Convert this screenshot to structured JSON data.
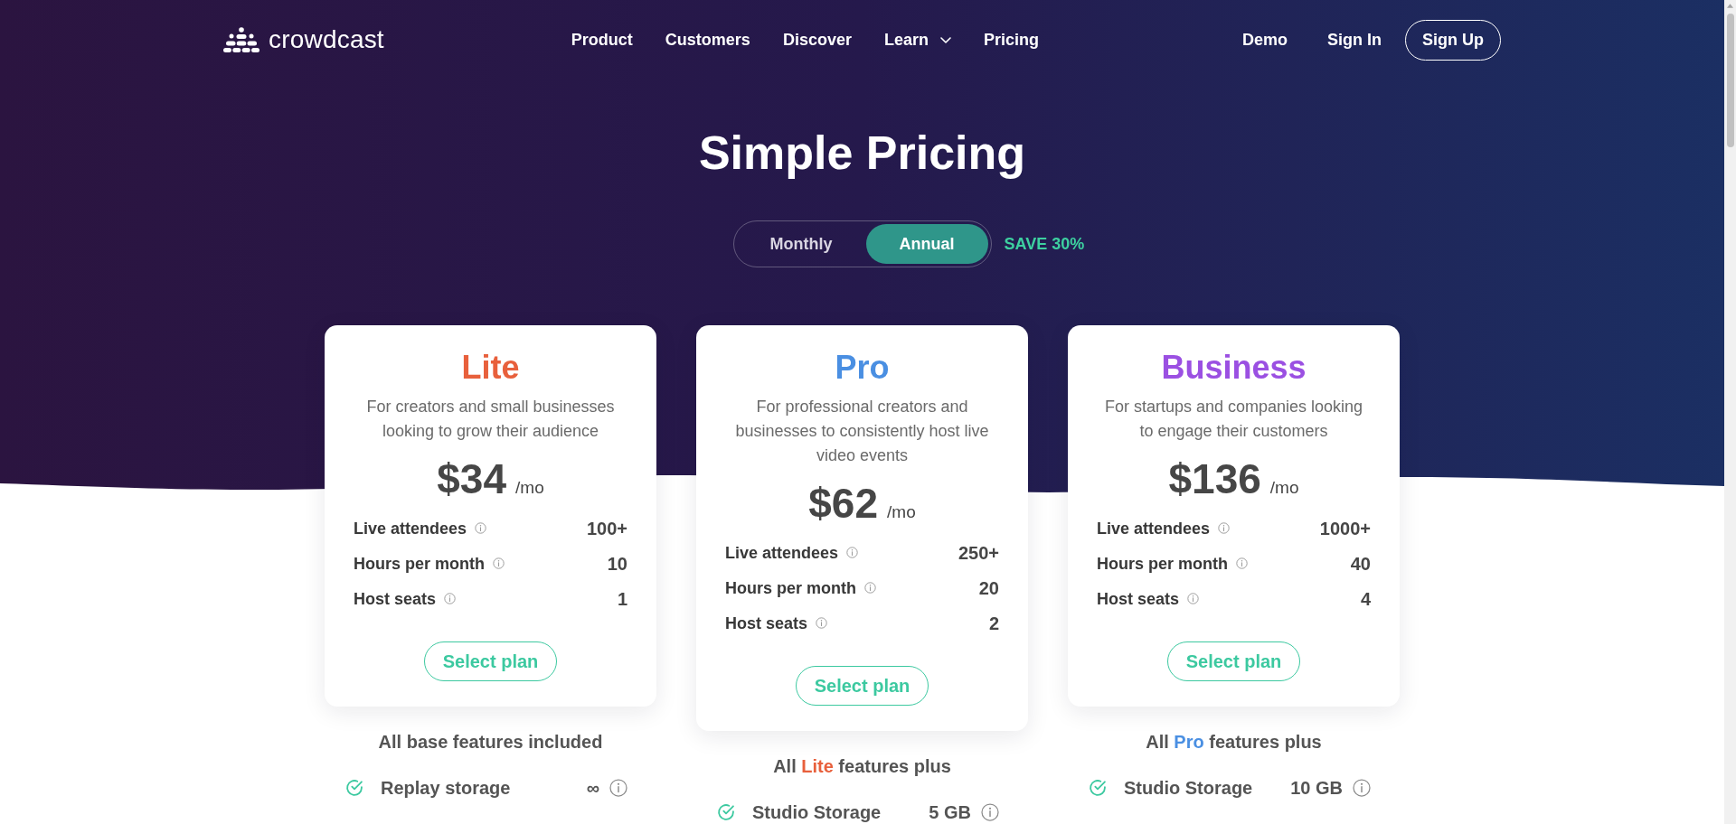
{
  "header": {
    "logo": "crowdcast",
    "nav": [
      {
        "label": "Product",
        "dropdown": false
      },
      {
        "label": "Customers",
        "dropdown": false
      },
      {
        "label": "Discover",
        "dropdown": false
      },
      {
        "label": "Learn",
        "dropdown": true
      },
      {
        "label": "Pricing",
        "dropdown": false
      }
    ],
    "actions": [
      {
        "label": "Demo",
        "kind": "link"
      },
      {
        "label": "Sign In",
        "kind": "link"
      },
      {
        "label": "Sign Up",
        "kind": "button"
      }
    ]
  },
  "hero": {
    "title": "Simple Pricing",
    "billing_toggle": {
      "options": [
        {
          "label": "Monthly",
          "selected": false
        },
        {
          "label": "Annual",
          "selected": true
        }
      ],
      "badge": "SAVE 30%"
    }
  },
  "plans": [
    {
      "name": "Lite",
      "color": "#e8603c",
      "description": "For creators and small businesses looking to grow their audience",
      "price": "$34",
      "period": "/mo",
      "stats": [
        {
          "label": "Live attendees",
          "value": "100+"
        },
        {
          "label": "Hours per month",
          "value": "10"
        },
        {
          "label": "Host seats",
          "value": "1"
        }
      ],
      "button": "Select plan",
      "features_heading": [
        {
          "text": "All base features included"
        }
      ],
      "features": [
        {
          "label": "Replay storage",
          "value": "∞"
        }
      ]
    },
    {
      "name": "Pro",
      "color": "#4a8fe2",
      "description": "For professional creators and businesses to consistently host live video events",
      "price": "$62",
      "period": "/mo",
      "stats": [
        {
          "label": "Live attendees",
          "value": "250+"
        },
        {
          "label": "Hours per month",
          "value": "20"
        },
        {
          "label": "Host seats",
          "value": "2"
        }
      ],
      "button": "Select plan",
      "features_heading": [
        {
          "text": "All "
        },
        {
          "text": "Lite",
          "color": "#e8603c"
        },
        {
          "text": " features plus"
        }
      ],
      "features": [
        {
          "label": "Studio Storage",
          "value": "5 GB"
        }
      ]
    },
    {
      "name": "Business",
      "color": "#9b50e2",
      "description": "For startups and companies looking to engage their customers",
      "price": "$136",
      "period": "/mo",
      "stats": [
        {
          "label": "Live attendees",
          "value": "1000+"
        },
        {
          "label": "Hours per month",
          "value": "40"
        },
        {
          "label": "Host seats",
          "value": "4"
        }
      ],
      "button": "Select plan",
      "features_heading": [
        {
          "text": "All "
        },
        {
          "text": "Pro",
          "color": "#4a8fe2"
        },
        {
          "text": " features plus"
        }
      ],
      "features": [
        {
          "label": "Studio Storage",
          "value": "10 GB"
        }
      ]
    }
  ]
}
